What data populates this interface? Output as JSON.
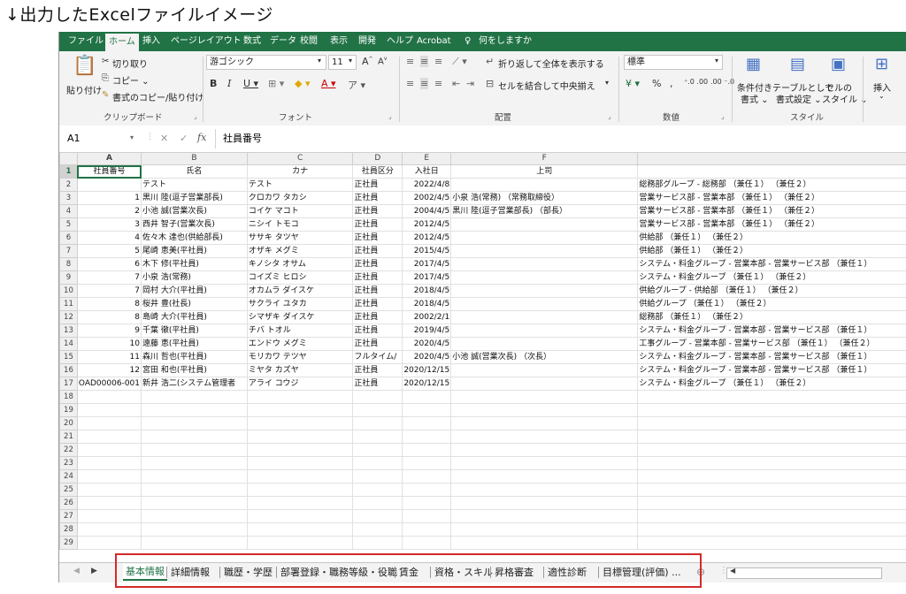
{
  "caption": "↓出力したExcelファイルイメージ",
  "menu": {
    "tabs": [
      "ファイル",
      "ホーム",
      "挿入",
      "ページレイアウト",
      "数式",
      "データ",
      "校閲",
      "表示",
      "開発",
      "ヘルプ",
      "Acrobat"
    ],
    "active_tab": "ホーム",
    "tellme": "何をしますか"
  },
  "ribbon": {
    "paste": "貼り付け",
    "cut": "切り取り",
    "copy": "コピー ⌄",
    "format_painter": "書式のコピー/貼り付け",
    "clipboard_group": "クリップボード",
    "font_name": "游ゴシック",
    "font_size": "11",
    "font_group": "フォント",
    "wrap_text": "折り返して全体を表示する",
    "merge_center": "セルを結合して中央揃え",
    "alignment_group": "配置",
    "number_format": "標準",
    "number_group": "数値",
    "cond_format": "条件付き",
    "cond_format2": "書式 ⌄",
    "table_format": "テーブルとして",
    "table_format2": "書式設定 ⌄",
    "cell_style": "セルの",
    "cell_style2": "スタイル ⌄",
    "styles_group": "スタイル",
    "insert": "挿入"
  },
  "formula_bar": {
    "name_box": "A1",
    "fx": "fx",
    "content": "社員番号"
  },
  "columns": [
    "A",
    "B",
    "C",
    "D",
    "E",
    "F"
  ],
  "headers": [
    "社員番号",
    "氏名",
    "カナ",
    "社員区分",
    "入社日",
    "上司"
  ],
  "rows": [
    [
      "",
      "テスト",
      "テスト",
      "正社員",
      "2022/4/8",
      "",
      "総務部グループ - 総務部 （兼任１） （兼任２）"
    ],
    [
      "1",
      "黒川 陸(逗子営業部長)",
      "クロカワ タカシ",
      "正社員",
      "2002/4/5",
      "小泉 浩(常務) （常務取締役）",
      "営業サービス部 - 営業本部 （兼任１） （兼任２）"
    ],
    [
      "2",
      "小池 誠(営業次長)",
      "コイケ マコト",
      "正社員",
      "2004/4/5",
      "黒川 陸(逗子営業部長) （部長）",
      "営業サービス部 - 営業本部 （兼任１） （兼任２）"
    ],
    [
      "3",
      "西井 智子(営業次長)",
      "ニシイ トモコ",
      "正社員",
      "2012/4/5",
      "",
      "営業サービス部 - 営業本部 （兼任１） （兼任２）"
    ],
    [
      "4",
      "佐々木 達也(供給部長)",
      "ササキ タツヤ",
      "正社員",
      "2012/4/5",
      "",
      "供給部 （兼任１） （兼任２）"
    ],
    [
      "5",
      "尾崎 恵美(平社員)",
      "オザキ メグミ",
      "正社員",
      "2015/4/5",
      "",
      "供給部 （兼任１） （兼任２）"
    ],
    [
      "6",
      "木下 修(平社員)",
      "キノシタ オサム",
      "正社員",
      "2017/4/5",
      "",
      "システム・料金グループ - 営業本部 - 営業サービス部 （兼任１）"
    ],
    [
      "7",
      "小泉 浩(常務)",
      "コイズミ ヒロシ",
      "正社員",
      "2017/4/5",
      "",
      "システム・料金グループ （兼任１） （兼任２）"
    ],
    [
      "7",
      "岡村 大介(平社員)",
      "オカムラ ダイスケ",
      "正社員",
      "2018/4/5",
      "",
      "供給グループ - 供給部 （兼任１） （兼任２）"
    ],
    [
      "8",
      "桜井 豊(社長)",
      "サクライ ユタカ",
      "正社員",
      "2018/4/5",
      "",
      "供給グループ （兼任１） （兼任２）"
    ],
    [
      "8",
      "島崎 大介(平社員)",
      "シマザキ ダイスケ",
      "正社員",
      "2002/2/1",
      "",
      "総務部 （兼任１） （兼任２）"
    ],
    [
      "9",
      "千葉 徹(平社員)",
      "チバ トオル",
      "正社員",
      "2019/4/5",
      "",
      "システム・料金グループ - 営業本部 - 営業サービス部 （兼任１）"
    ],
    [
      "10",
      "遠藤 恵(平社員)",
      "エンドウ メグミ",
      "正社員",
      "2020/4/5",
      "",
      "工事グループ - 営業本部 - 営業サービス部 （兼任１） （兼任２）"
    ],
    [
      "11",
      "森川 哲也(平社員)",
      "モリカワ テツヤ",
      "フルタイム/",
      "2020/4/5",
      "小池 誠(営業次長) （次長）",
      "システム・料金グループ - 営業本部 - 営業サービス部 （兼任１）"
    ],
    [
      "12",
      "宮田 和也(平社員)",
      "ミヤタ カズヤ",
      "正社員",
      "2020/12/15",
      "",
      "システム・料金グループ - 営業本部 - 営業サービス部 （兼任１）"
    ],
    [
      "OAD00006-001",
      "新井 浩二(システム管理者",
      "アライ コウジ",
      "正社員",
      "2020/12/15",
      "",
      "システム・料金グループ （兼任１） （兼任２）"
    ]
  ],
  "row_numbers": [
    "1",
    "2",
    "3",
    "4",
    "5",
    "6",
    "7",
    "8",
    "9",
    "10",
    "11",
    "12",
    "13",
    "14",
    "15",
    "16",
    "17",
    "18",
    "19",
    "20",
    "21",
    "22",
    "23",
    "24",
    "25",
    "26",
    "27",
    "28",
    "29"
  ],
  "sheet_tabs": [
    "基本情報",
    "詳細情報",
    "職歴・学歴",
    "部署登録・職務等級・役職",
    "賃金",
    "資格・スキル",
    "昇格審査",
    "適性診断",
    "目標管理(評価) ..."
  ],
  "active_sheet": "基本情報",
  "colors": {
    "excel_green": "#217346",
    "highlight_red": "#d42a2a"
  }
}
